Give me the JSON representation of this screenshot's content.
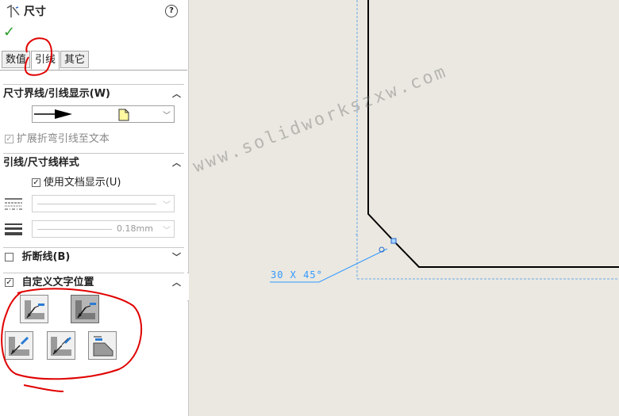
{
  "panel": {
    "title": "尺寸",
    "help_icon": "?",
    "ok_icon": "✓",
    "tabs": [
      {
        "label": "数值"
      },
      {
        "label": "引线",
        "active": true
      },
      {
        "label": "其它"
      }
    ],
    "sections": {
      "leader_display": {
        "title": "尺寸界线/引线显示(W)",
        "extend_bent_leader": "扩展折弯引线至文本"
      },
      "leader_style": {
        "title": "引线/尺寸线样式",
        "use_doc_display": "使用文档显示(U)",
        "line_thickness": "0.18mm"
      },
      "break_lines": {
        "title": "折断线(B)"
      },
      "custom_text_position": {
        "title": "自定义文字位置"
      }
    }
  },
  "canvas": {
    "dimension_text": "30 X 45°",
    "watermark": "www.solidworkszxw.com"
  },
  "colors": {
    "accent_check": "#2a9a2a",
    "annotation_red": "#e00000",
    "dimension_blue": "#3399ff"
  }
}
